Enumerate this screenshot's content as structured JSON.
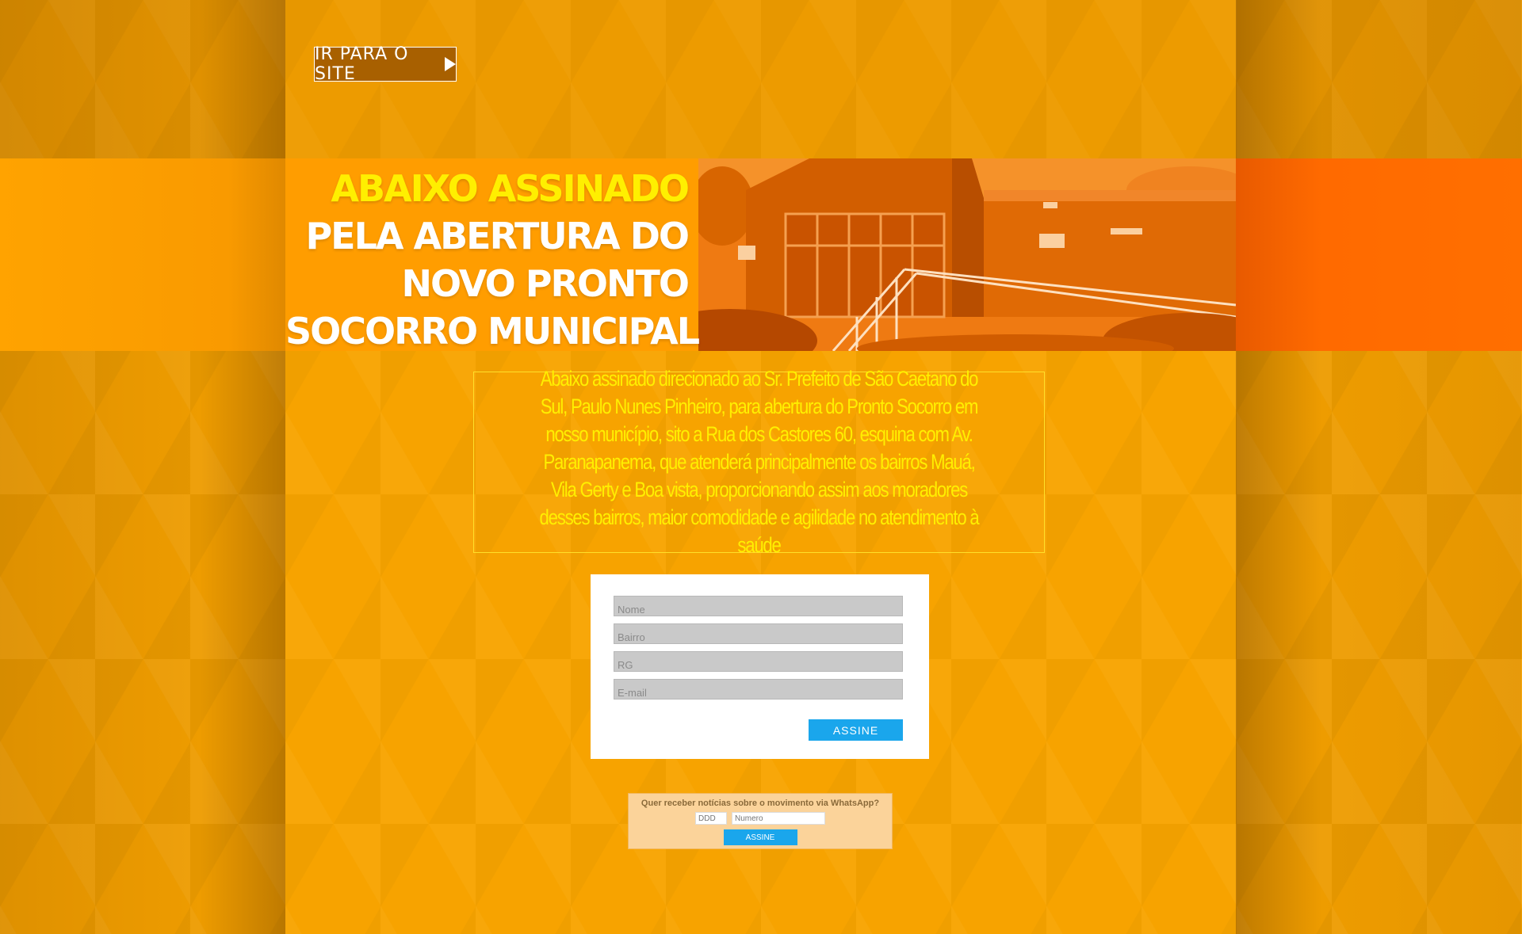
{
  "header": {
    "site_button_label": "IR PARA O SITE"
  },
  "hero": {
    "title_line_1": "ABAIXO ASSINADO",
    "title_line_2": "PELA ABERTURA DO",
    "title_line_3": "NOVO PRONTO",
    "title_line_4": "SOCORRO MUNICIPAL",
    "highlight_color": "#ffef00"
  },
  "intro": {
    "text": "Abaixo assinado direcionado ao Sr. Prefeito de São Caetano do Sul, Paulo Nunes Pinheiro, para abertura do Pronto Socorro em nosso município, sito a Rua dos Castores 60, esquina com Av. Paranapanema, que atenderá principalmente os bairros Mauá, Vila Gerty e Boa vista, proporcionando assim aos moradores desses bairros, maior comodidade e agilidade no atendimento à saúde"
  },
  "form": {
    "name_placeholder": "Nome",
    "bairro_placeholder": "Bairro",
    "rg_placeholder": "RG",
    "email_placeholder": "E-mail",
    "submit_label": "ASSINE",
    "submit_color": "#1aa6ec"
  },
  "whatsapp": {
    "question": "Quer receber notícias sobre o movimento via WhatsApp?",
    "ddd_placeholder": "DDD",
    "number_placeholder": "Numero",
    "submit_label": "ASSINE"
  },
  "colors": {
    "background": "#f5a100",
    "hero_band_right": "#ff6f00"
  }
}
